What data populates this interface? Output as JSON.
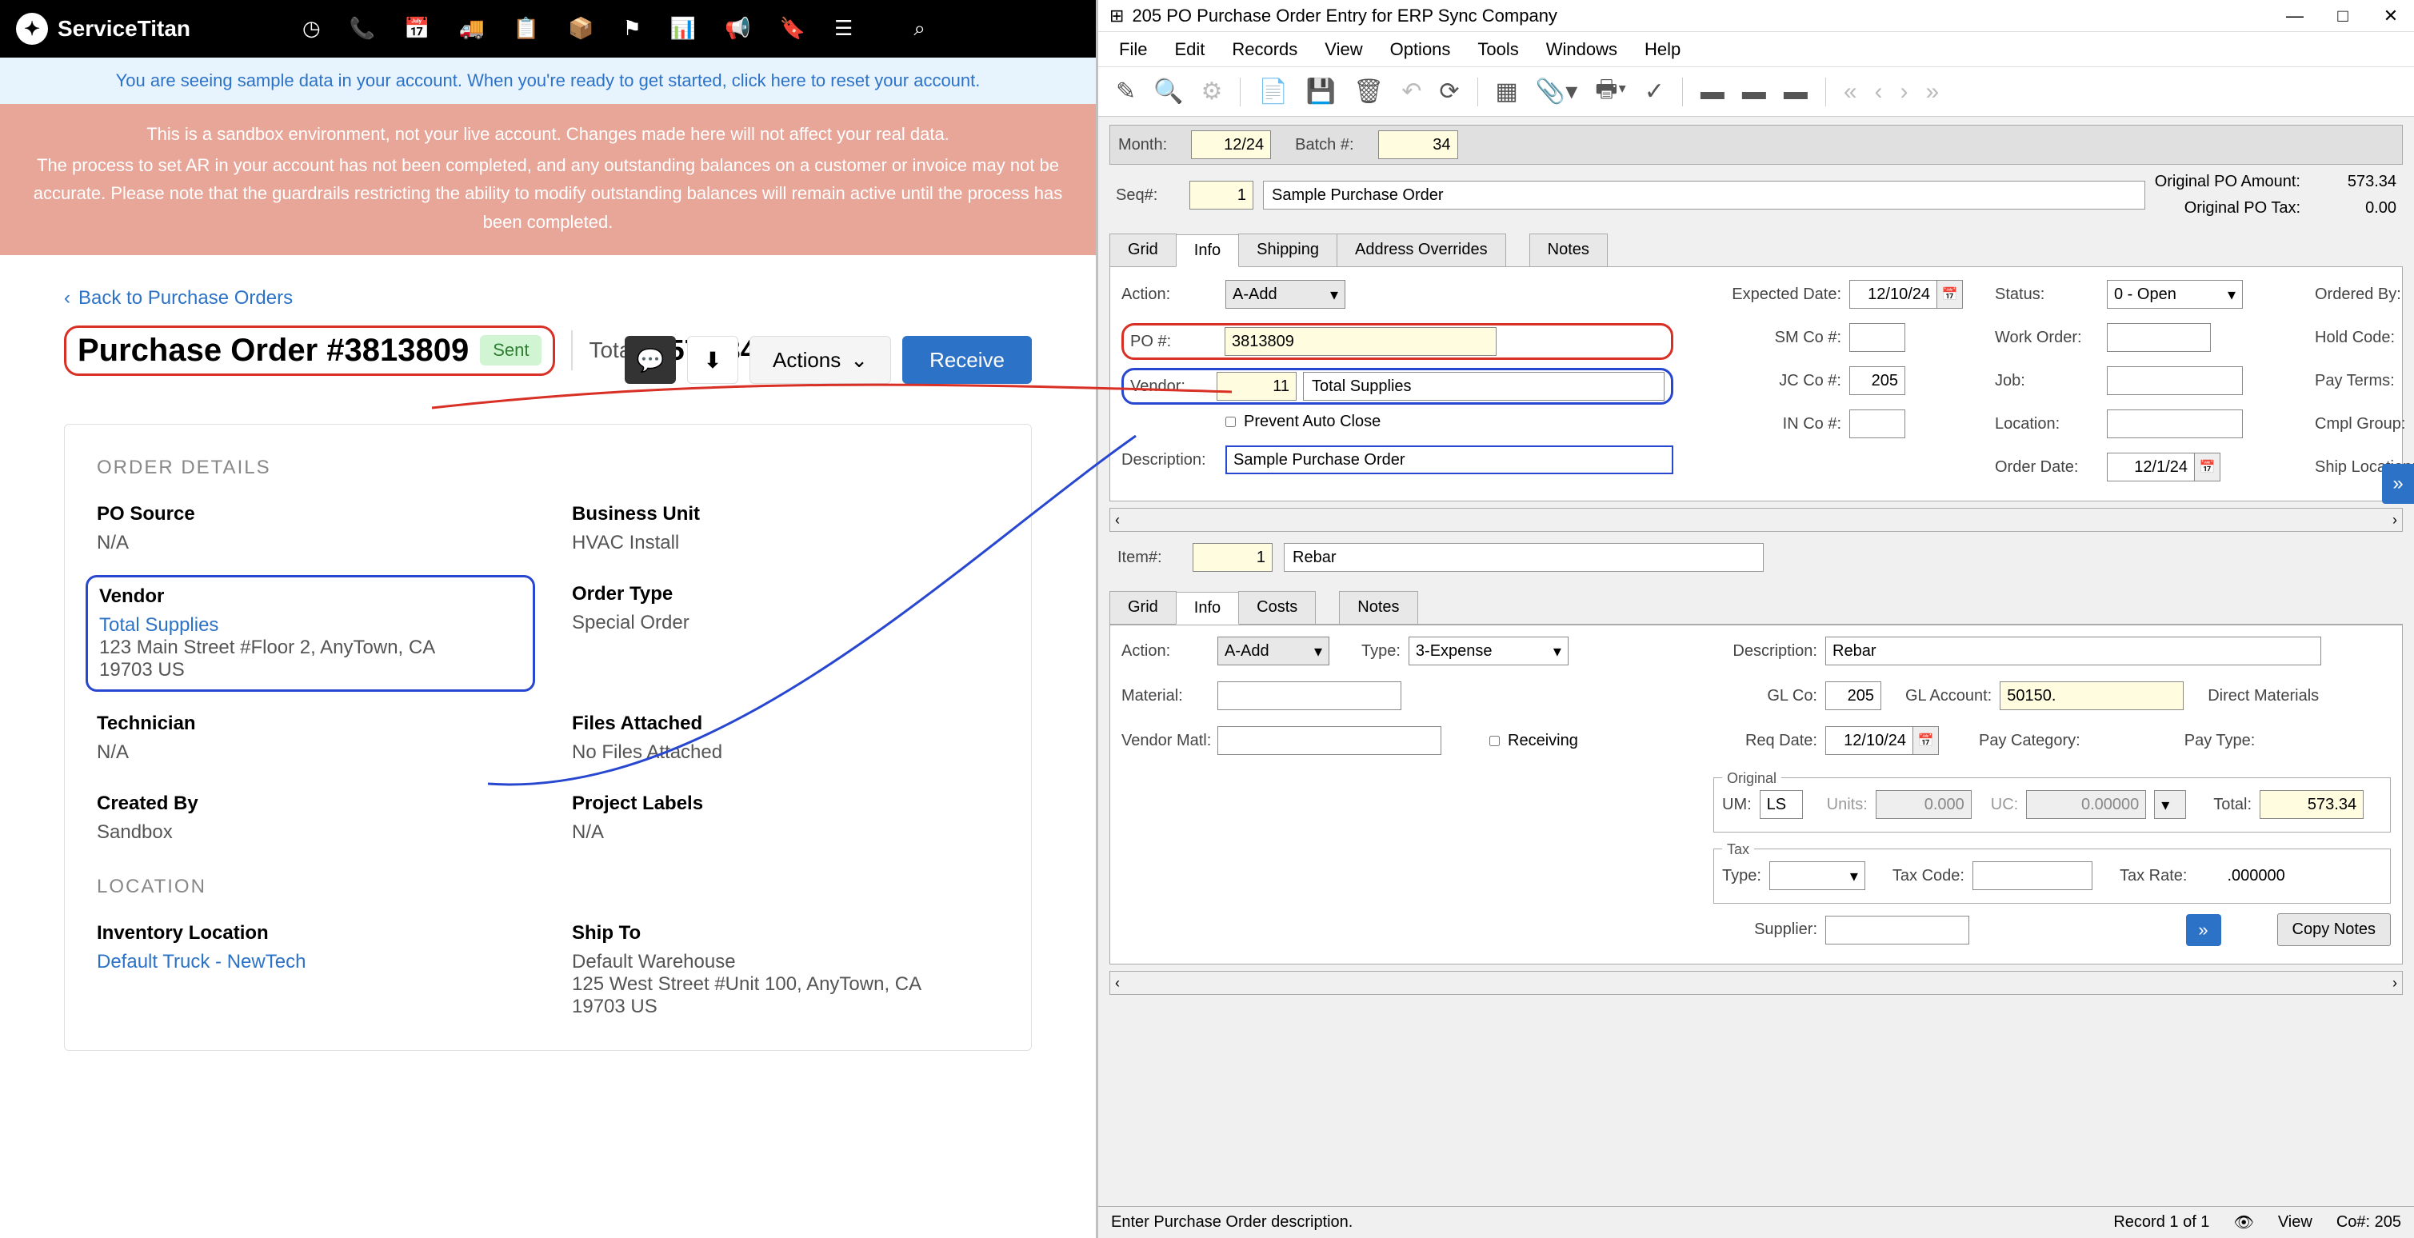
{
  "st": {
    "brand": "ServiceTitan",
    "blueBanner": "You are seeing sample data in your account. When you're ready to get started, click here to reset your account.",
    "pink1": "This is a sandbox environment, not your live account. Changes made here will not affect your real data.",
    "pink2": "The process to set AR in your account has not been completed, and any outstanding balances on a customer or invoice may not be accurate. Please note that the guardrails restricting the ability to modify outstanding balances will remain active until the process has been completed.",
    "back": "Back to Purchase Orders",
    "poTitle": "Purchase Order #3813809",
    "sent": "Sent",
    "totalLabel": "Total",
    "totalAmount": "$578.34",
    "actions": "Actions",
    "receive": "Receive",
    "orderDetails": "ORDER DETAILS",
    "location": "LOCATION",
    "fields": {
      "poSourceL": "PO Source",
      "poSourceV": "N/A",
      "buL": "Business Unit",
      "buV": "HVAC Install",
      "vendorL": "Vendor",
      "vendorLink": "Total Supplies",
      "vendorAddr1": "123 Main Street #Floor 2, AnyTown, CA",
      "vendorAddr2": "19703 US",
      "orderTypeL": "Order Type",
      "orderTypeV": "Special Order",
      "techL": "Technician",
      "techV": "N/A",
      "filesL": "Files Attached",
      "filesV": "No Files Attached",
      "createdL": "Created By",
      "createdV": "Sandbox",
      "projL": "Project Labels",
      "projV": "N/A",
      "invLocL": "Inventory Location",
      "invLocLink": "Default Truck - NewTech",
      "shipL": "Ship To",
      "shipV1": "Default Warehouse",
      "shipV2": "125 West Street #Unit 100, AnyTown, CA",
      "shipV3": "19703 US"
    }
  },
  "erp": {
    "winTitle": "205 PO Purchase Order Entry for ERP Sync Company",
    "menus": [
      "File",
      "Edit",
      "Records",
      "View",
      "Options",
      "Tools",
      "Windows",
      "Help"
    ],
    "monthL": "Month:",
    "monthV": "12/24",
    "batchL": "Batch #:",
    "batchV": "34",
    "seqL": "Seq#:",
    "seqV": "1",
    "seqText": "Sample Purchase Order",
    "origAmtL": "Original PO Amount:",
    "origAmtV": "573.34",
    "origTaxL": "Original PO Tax:",
    "origTaxV": "0.00",
    "tabs": [
      "Grid",
      "Info",
      "Shipping",
      "Address Overrides",
      "Notes"
    ],
    "info": {
      "actionL": "Action:",
      "actionV": "A-Add",
      "poL": "PO #:",
      "poV": "3813809",
      "vendorL": "Vendor:",
      "vendorV": "11",
      "vendorName": "Total Supplies",
      "preventL": "Prevent Auto Close",
      "descL": "Description:",
      "descV": "Sample Purchase Order",
      "expL": "Expected Date:",
      "expV": "12/10/24",
      "smL": "SM Co #:",
      "smV": "",
      "jcL": "JC Co #:",
      "jcV": "205",
      "inL": "IN Co #:",
      "inV": "",
      "statusL": "Status:",
      "statusV": "0 - Open",
      "woL": "Work Order:",
      "jobL": "Job:",
      "locL": "Location:",
      "orderDateL": "Order Date:",
      "orderDateV": "12/1/24",
      "orderedL": "Ordered By:",
      "holdL": "Hold Code:",
      "payTermsL": "Pay Terms:",
      "cmplL": "Cmpl Group:",
      "shipLocL": "Ship Location:"
    },
    "itemL": "Item#:",
    "itemV": "1",
    "itemText": "Rebar",
    "tabs2": [
      "Grid",
      "Info",
      "Costs",
      "Notes"
    ],
    "line": {
      "actionL": "Action:",
      "actionV": "A-Add",
      "typeL": "Type:",
      "typeV": "3-Expense",
      "matL": "Material:",
      "vmatL": "Vendor Matl:",
      "recvL": "Receiving",
      "descL": "Description:",
      "descV": "Rebar",
      "glcoL": "GL Co:",
      "glcoV": "205",
      "glacctL": "GL Account:",
      "glacctV": "50150.",
      "glacctDesc": "Direct Materials",
      "reqL": "Req Date:",
      "reqV": "12/10/24",
      "paycatL": "Pay Category:",
      "paytypeL": "Pay Type:",
      "origL": "Original",
      "umL": "UM:",
      "umV": "LS",
      "unitsL": "Units:",
      "unitsV": "0.000",
      "ucL": "UC:",
      "ucV": "0.00000",
      "totalL": "Total:",
      "totalV": "573.34",
      "taxL": "Tax",
      "taxTypeL": "Type:",
      "taxCodeL": "Tax Code:",
      "taxRateL": "Tax Rate:",
      "taxRateV": ".000000",
      "suppL": "Supplier:",
      "copyL": "Copy Notes"
    },
    "statusText": "Enter Purchase Order description.",
    "recLabel": "Record 1 of 1",
    "viewL": "View",
    "coL": "Co#: 205"
  }
}
